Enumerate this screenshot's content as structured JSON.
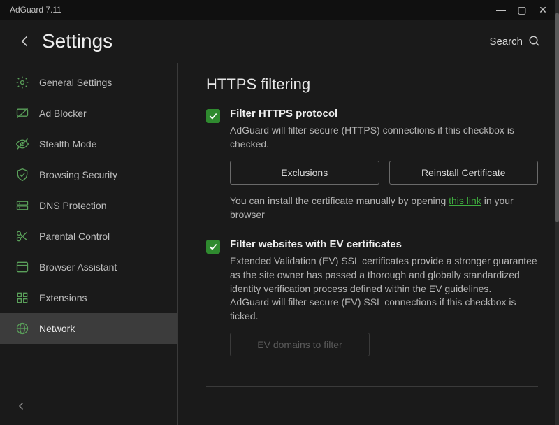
{
  "window": {
    "title": "AdGuard 7.11"
  },
  "header": {
    "title": "Settings",
    "search_label": "Search"
  },
  "sidebar": {
    "items": [
      {
        "label": "General Settings",
        "icon": "gear-icon"
      },
      {
        "label": "Ad Blocker",
        "icon": "message-slash-icon"
      },
      {
        "label": "Stealth Mode",
        "icon": "eye-slash-icon"
      },
      {
        "label": "Browsing Security",
        "icon": "shield-icon"
      },
      {
        "label": "DNS Protection",
        "icon": "server-icon"
      },
      {
        "label": "Parental Control",
        "icon": "scissors-icon"
      },
      {
        "label": "Browser Assistant",
        "icon": "window-icon"
      },
      {
        "label": "Extensions",
        "icon": "grid-icon"
      },
      {
        "label": "Network",
        "icon": "globe-icon"
      }
    ],
    "active_index": 8
  },
  "content": {
    "section_title": "HTTPS filtering",
    "https": {
      "checked": true,
      "title": "Filter HTTPS protocol",
      "desc": "AdGuard will filter secure (HTTPS) connections if this checkbox is checked.",
      "exclusions_btn": "Exclusions",
      "reinstall_btn": "Reinstall Certificate",
      "note_pre": "You can install the certificate manually by opening ",
      "note_link": "this link",
      "note_post": " in your browser"
    },
    "ev": {
      "checked": true,
      "title": "Filter websites with EV certificates",
      "desc1": "Extended Validation (EV) SSL certificates provide a stronger guarantee as the site owner has passed a thorough and globally standardized identity verification process defined within the EV guidelines.",
      "desc2": "AdGuard will filter secure (EV) SSL connections if this checkbox is ticked.",
      "ev_btn": "EV domains to filter"
    }
  }
}
